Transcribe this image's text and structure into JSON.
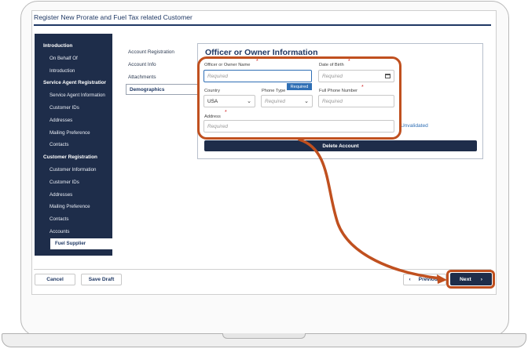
{
  "window": {
    "title": "Register New Prorate and Fuel Tax related Customer"
  },
  "nav": {
    "items": [
      {
        "label": "Introduction",
        "kind": "head"
      },
      {
        "label": "On Behalf Of",
        "kind": "sub"
      },
      {
        "label": "Introduction",
        "kind": "sub"
      },
      {
        "label": "Service Agent Registration",
        "kind": "head"
      },
      {
        "label": "Service Agent Information",
        "kind": "sub"
      },
      {
        "label": "Customer IDs",
        "kind": "sub"
      },
      {
        "label": "Addresses",
        "kind": "sub"
      },
      {
        "label": "Mailing Preference",
        "kind": "sub"
      },
      {
        "label": "Contacts",
        "kind": "sub"
      },
      {
        "label": "Customer Registration",
        "kind": "head"
      },
      {
        "label": "Customer Information",
        "kind": "sub"
      },
      {
        "label": "Customer IDs",
        "kind": "sub"
      },
      {
        "label": "Addresses",
        "kind": "sub"
      },
      {
        "label": "Mailing Preference",
        "kind": "sub"
      },
      {
        "label": "Contacts",
        "kind": "sub"
      },
      {
        "label": "Accounts",
        "kind": "sub"
      },
      {
        "label": "Fuel Supplier",
        "kind": "active"
      }
    ]
  },
  "steps": {
    "items": [
      "Account Registration",
      "Account Info",
      "Attachments",
      "Demographics"
    ],
    "active": "Demographics"
  },
  "form": {
    "heading": "Officer or Owner Information",
    "required_marker": "*",
    "officer_name": {
      "label": "Officer or Owner Name",
      "placeholder": "Required",
      "tooltip": "Required"
    },
    "dob": {
      "label": "Date of Birth",
      "placeholder": "Required"
    },
    "country": {
      "label": "Country",
      "value": "USA"
    },
    "phone_type": {
      "label": "Phone Type",
      "placeholder": "Required"
    },
    "full_phone": {
      "label": "Full Phone Number",
      "placeholder": "Required"
    },
    "address": {
      "label": "Address",
      "placeholder": "Required"
    },
    "unvalidated_link": "Unvalidated",
    "delete_button": "Delete Account"
  },
  "footer": {
    "cancel": "Cancel",
    "save_draft": "Save Draft",
    "previous": "Previous",
    "next": "Next"
  },
  "colors": {
    "navy": "#1e2d4a",
    "accent_blue": "#2f6fb5",
    "annotation": "#c0501f",
    "required": "#d02020"
  }
}
